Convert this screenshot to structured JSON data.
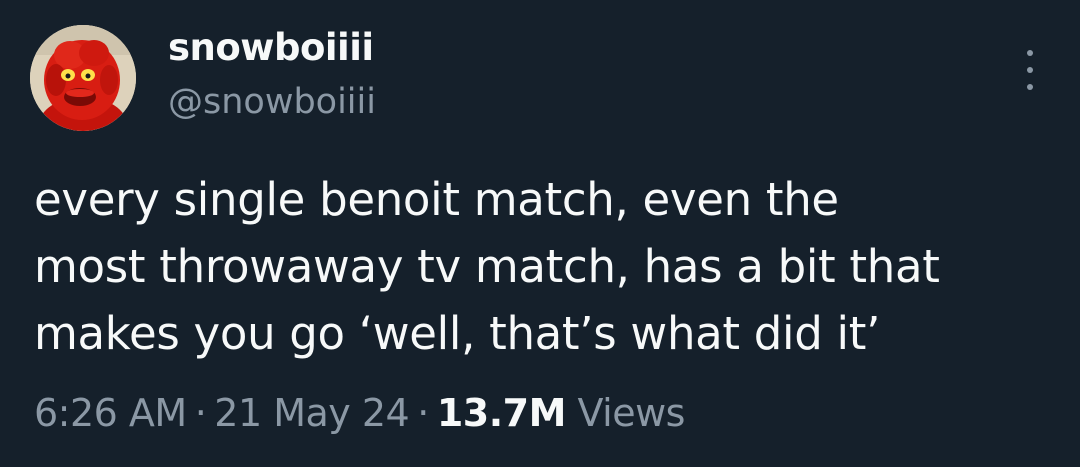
{
  "tweet": {
    "author": {
      "display_name": "snowboiiii",
      "handle": "@snowboiiii",
      "avatar_icon": "red-muppet-avatar"
    },
    "more_icon": "more-vertical-icon",
    "text_lines": [
      "every single benoit match, even the",
      "most throwaway tv match, has a bit that",
      "makes you go ‘well, that’s what did it’"
    ],
    "time": "6:26 AM",
    "separator": "·",
    "date": "21 May 24",
    "views_count": "13.7M",
    "views_label": "Views"
  },
  "colors": {
    "background": "#15202b",
    "primary_text": "#f7f9f9",
    "secondary_text": "#8b98a5"
  }
}
